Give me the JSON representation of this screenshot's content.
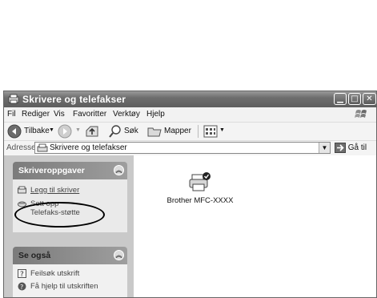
{
  "window": {
    "title": "Skrivere og telefakser"
  },
  "menubar": [
    "Fil",
    "Rediger",
    "Vis",
    "Favoritter",
    "Verktøy",
    "Hjelp"
  ],
  "toolbar": {
    "back_label": "Tilbake",
    "search_label": "Søk",
    "folders_label": "Mapper"
  },
  "address": {
    "label": "Adresse",
    "value": "Skrivere og telefakser",
    "go_label": "Gå til"
  },
  "taskpane": {
    "printer_tasks": {
      "title": "Skriveroppgaver",
      "items": [
        "Legg til skriver",
        "Sett opp",
        "Telefaks-støtte"
      ]
    },
    "see_also": {
      "title": "Se også",
      "items": [
        "Feilsøk utskrift",
        "Få hjelp til utskriften"
      ]
    }
  },
  "content": {
    "printer_name": "Brother MFC-XXXX"
  },
  "colors": {
    "titlebar": "#6e6e6e",
    "taskpane": "#c9c9c9",
    "panel_header": "#8c8c8c"
  }
}
